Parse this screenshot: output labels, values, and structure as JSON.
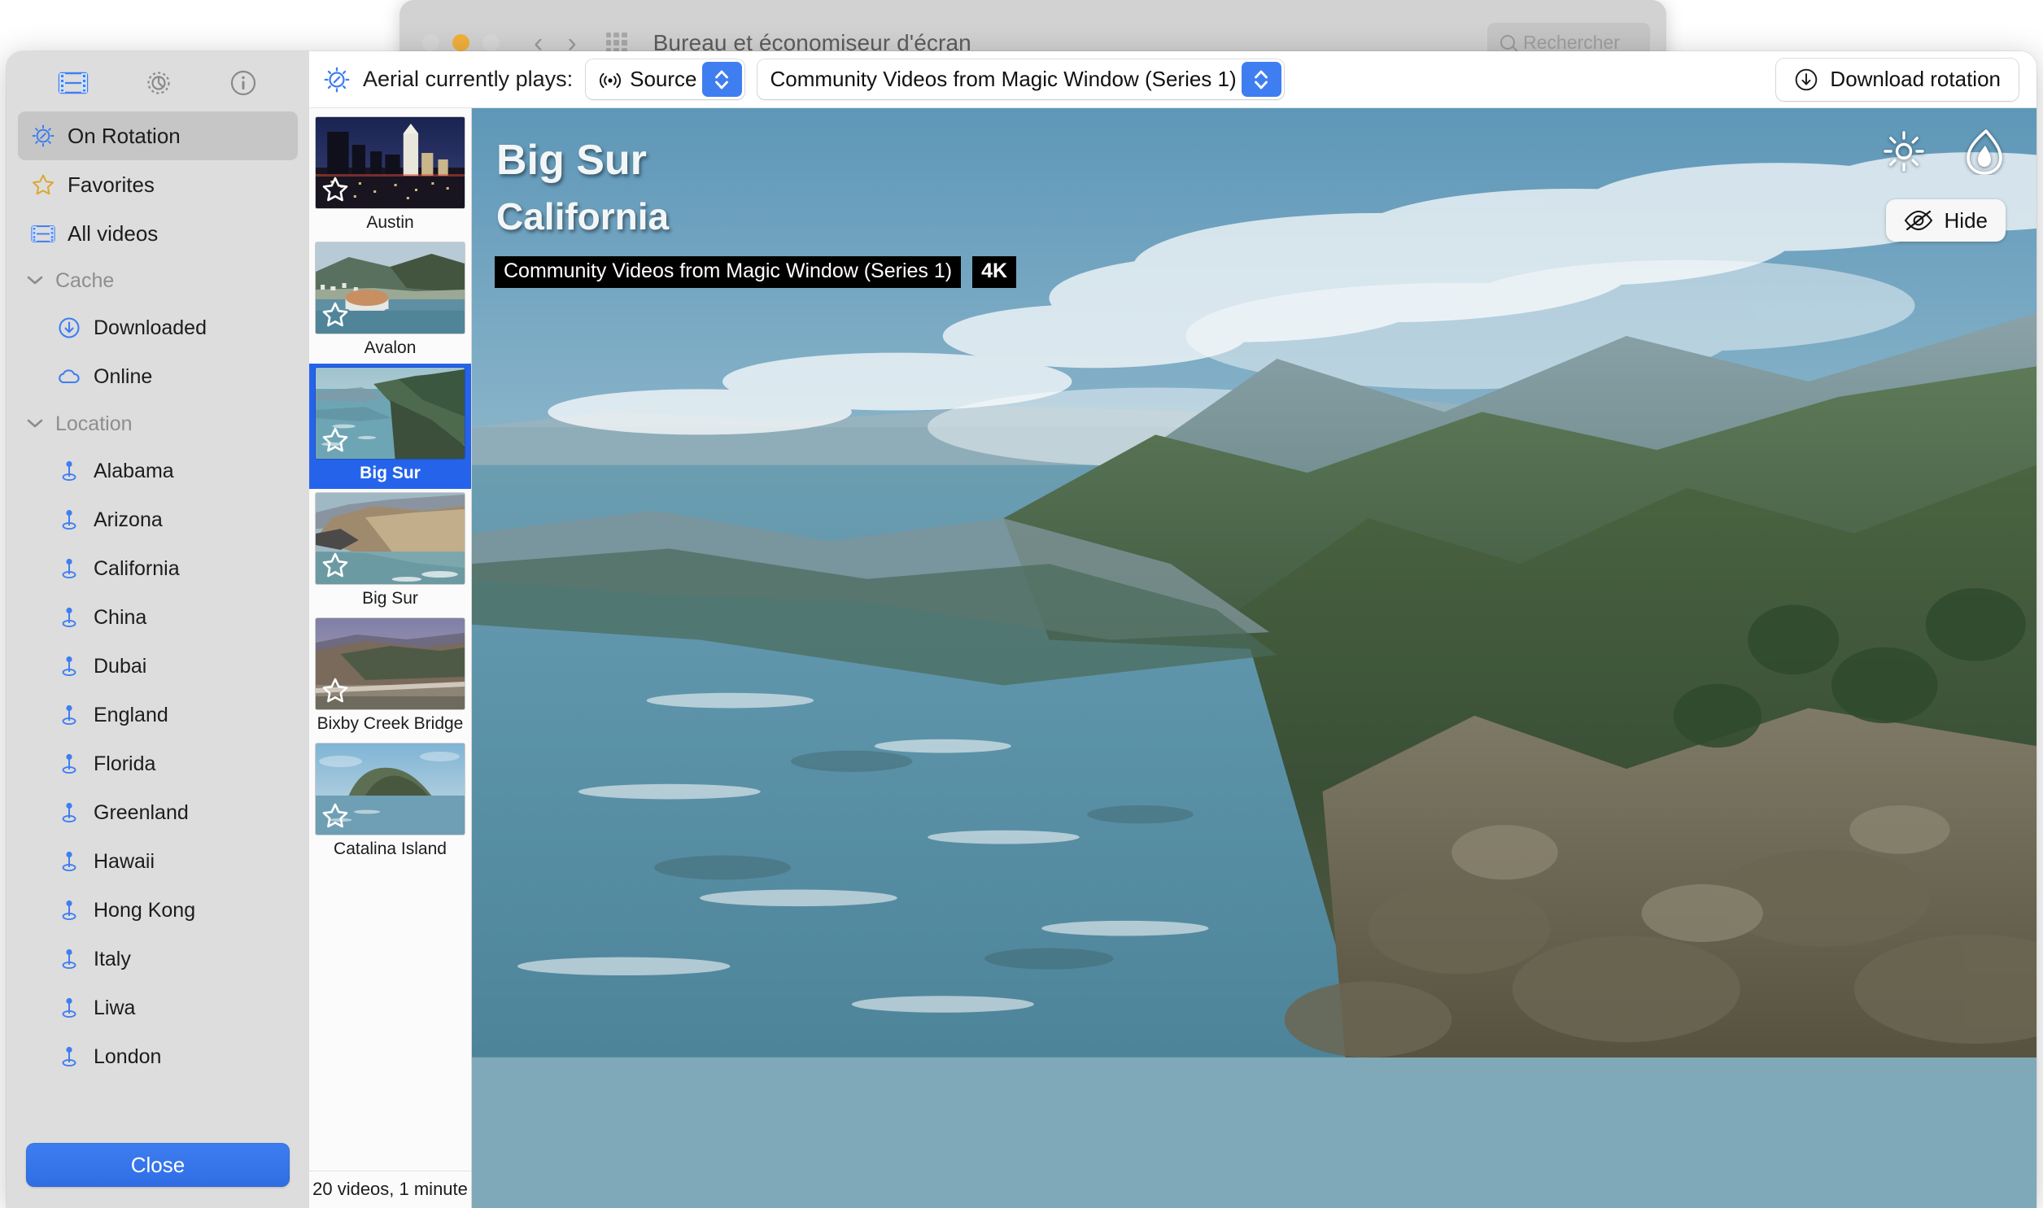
{
  "background_window": {
    "title": "Bureau et économiseur d'écran",
    "search_placeholder": "Rechercher",
    "traffic_lights": [
      "close",
      "minimize",
      "zoom"
    ],
    "nav_back": "‹",
    "nav_forward": "›"
  },
  "sidebar": {
    "tabs": [
      {
        "name": "videos-tab",
        "icon": "film-icon",
        "selected": true
      },
      {
        "name": "settings-tab",
        "icon": "gear-icon",
        "selected": false
      },
      {
        "name": "info-tab",
        "icon": "info-icon",
        "selected": false
      }
    ],
    "items": [
      {
        "label": "On Rotation",
        "icon": "rotation-icon",
        "selected": true,
        "type": "row"
      },
      {
        "label": "Favorites",
        "icon": "star-icon",
        "selected": false,
        "type": "row"
      },
      {
        "label": "All videos",
        "icon": "film-icon",
        "selected": false,
        "type": "row"
      },
      {
        "label": "Cache",
        "icon": "chevron-down-icon",
        "type": "group"
      },
      {
        "label": "Downloaded",
        "icon": "download-circle-icon",
        "type": "child"
      },
      {
        "label": "Online",
        "icon": "cloud-icon",
        "type": "child"
      },
      {
        "label": "Location",
        "icon": "chevron-down-icon",
        "type": "group"
      },
      {
        "label": "Alabama",
        "icon": "pin-icon",
        "type": "child"
      },
      {
        "label": "Arizona",
        "icon": "pin-icon",
        "type": "child"
      },
      {
        "label": "California",
        "icon": "pin-icon",
        "type": "child"
      },
      {
        "label": "China",
        "icon": "pin-icon",
        "type": "child"
      },
      {
        "label": "Dubai",
        "icon": "pin-icon",
        "type": "child"
      },
      {
        "label": "England",
        "icon": "pin-icon",
        "type": "child"
      },
      {
        "label": "Florida",
        "icon": "pin-icon",
        "type": "child"
      },
      {
        "label": "Greenland",
        "icon": "pin-icon",
        "type": "child"
      },
      {
        "label": "Hawaii",
        "icon": "pin-icon",
        "type": "child"
      },
      {
        "label": "Hong Kong",
        "icon": "pin-icon",
        "type": "child"
      },
      {
        "label": "Italy",
        "icon": "pin-icon",
        "type": "child"
      },
      {
        "label": "Liwa",
        "icon": "pin-icon",
        "type": "child"
      },
      {
        "label": "London",
        "icon": "pin-icon",
        "type": "child"
      }
    ],
    "close_label": "Close"
  },
  "toolbar": {
    "rotation_icon": "rotation-icon",
    "plays_label": "Aerial currently plays:",
    "source_popup": {
      "icon": "broadcast-icon",
      "value": "Source"
    },
    "series_popup": {
      "value": "Community Videos from Magic Window (Series 1)"
    },
    "download_button": {
      "icon": "download-circle-icon",
      "label": "Download rotation"
    }
  },
  "thumbnails": {
    "items": [
      {
        "caption": "Austin",
        "selected": false,
        "scene": "austin"
      },
      {
        "caption": "Avalon",
        "selected": false,
        "scene": "avalon"
      },
      {
        "caption": "Big Sur",
        "selected": true,
        "scene": "bigsur1"
      },
      {
        "caption": "Big Sur",
        "selected": false,
        "scene": "bigsur2"
      },
      {
        "caption": "Bixby Creek Bridge",
        "selected": false,
        "scene": "bixby"
      },
      {
        "caption": "Catalina Island",
        "selected": false,
        "scene": "catalina"
      }
    ],
    "footer": "20 videos, 1 minute"
  },
  "preview": {
    "title": "Big Sur",
    "subtitle": "California",
    "source_badge": "Community Videos from Magic Window (Series 1)",
    "quality_badge": "4K",
    "tools": [
      {
        "name": "brightness-icon"
      },
      {
        "name": "flame-icon"
      }
    ],
    "hide_button": {
      "icon": "eye-slash-icon",
      "label": "Hide"
    }
  },
  "colors": {
    "accent_blue": "#2563eb",
    "popup_chevron_blue": "#3f7ef1",
    "sidebar_bg": "#dddddd",
    "selected_row_bg": "#c6c6c6",
    "panel_bg": "#ececec"
  }
}
